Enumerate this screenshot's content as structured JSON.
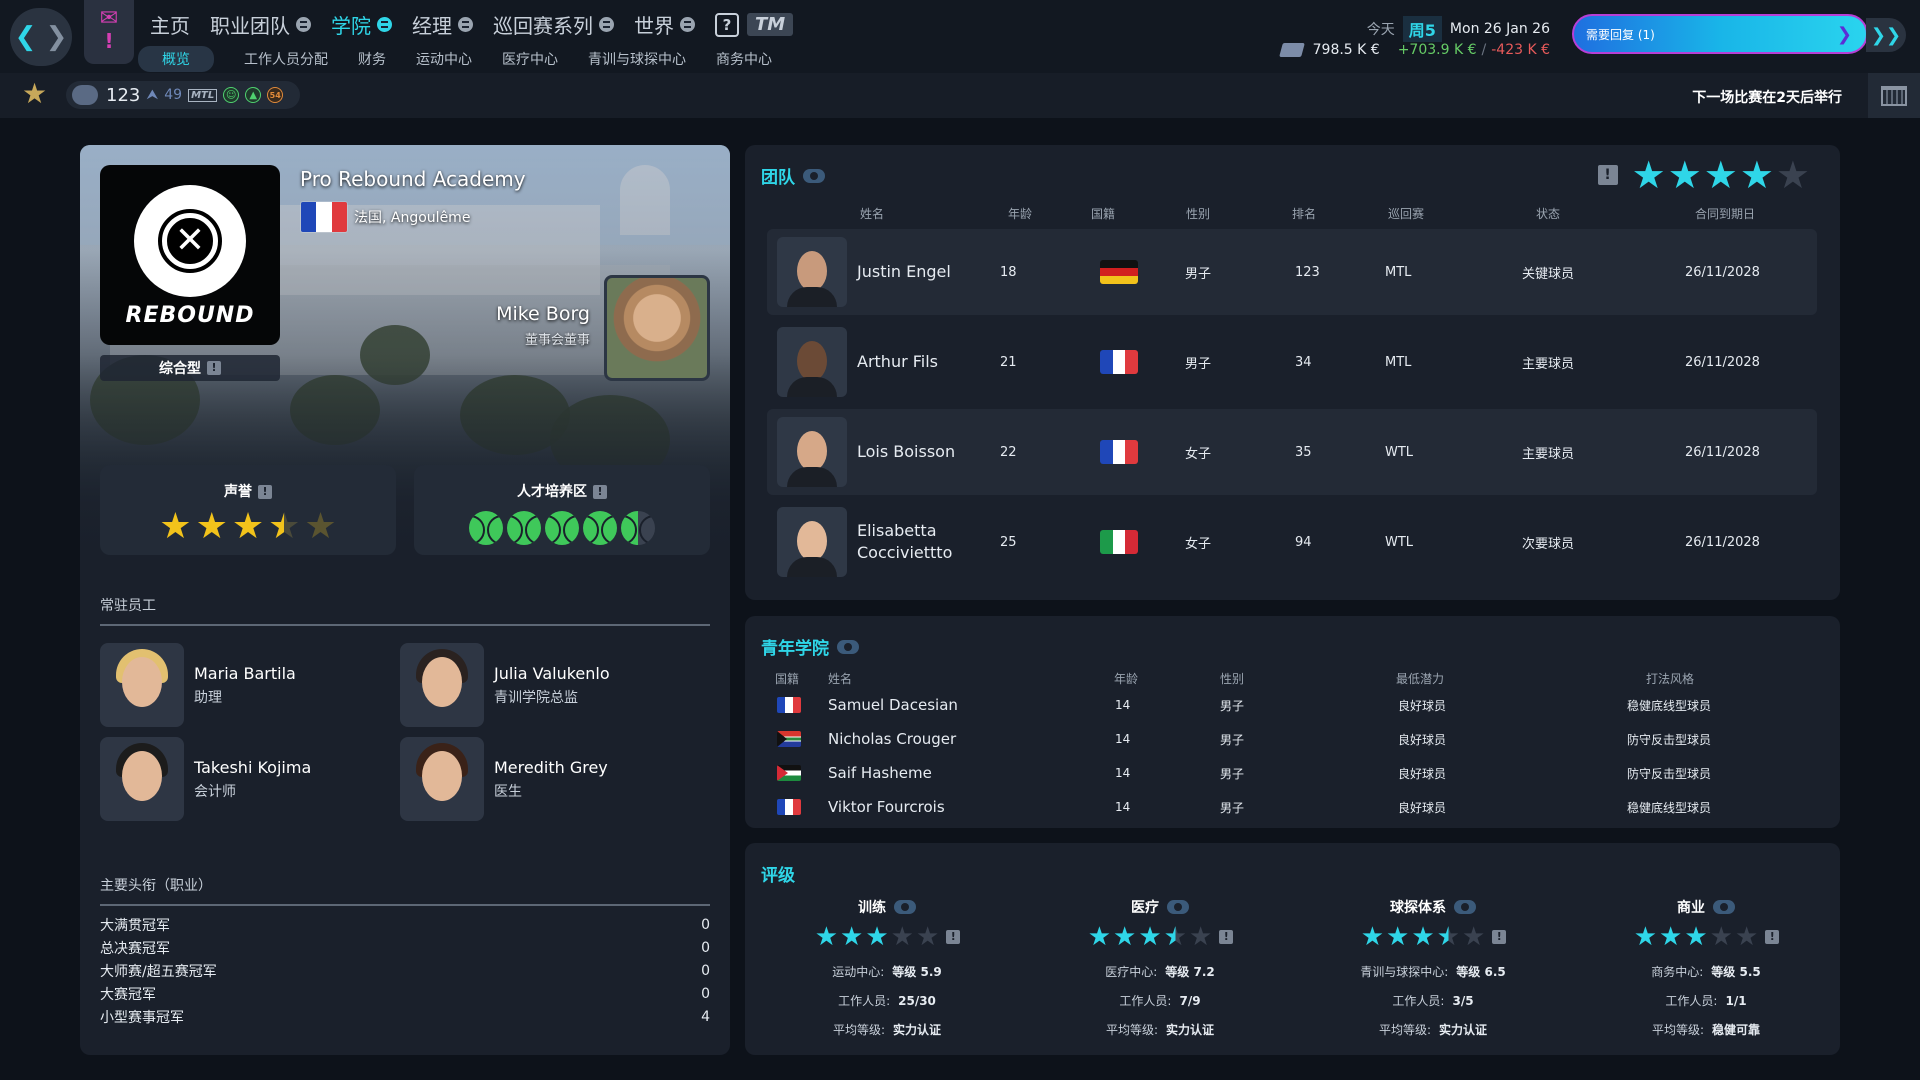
{
  "nav": {
    "back_icon": "chevron-left-icon",
    "forward_icon": "chevron-right-icon",
    "main": [
      {
        "label": "主页",
        "menu": false,
        "active": false
      },
      {
        "label": "职业团队",
        "menu": true,
        "active": false
      },
      {
        "label": "学院",
        "menu": true,
        "active": true
      },
      {
        "label": "经理",
        "menu": true,
        "active": false
      },
      {
        "label": "巡回赛系列",
        "menu": true,
        "active": false
      },
      {
        "label": "世界",
        "menu": true,
        "active": false
      }
    ],
    "help_label": "?",
    "tm_logo": "TM",
    "sub": [
      "概览",
      "工作人员分配",
      "财务",
      "运动中心",
      "医疗中心",
      "青训与球探中心",
      "商务中心"
    ]
  },
  "header": {
    "today_label": "今天",
    "week_label": "周5",
    "date": "Mon 26 Jan 26",
    "balance": "798.5 K €",
    "income": "+703.9 K €",
    "expense": "-423 K €",
    "reply_label": "需要回复 (1)"
  },
  "status": {
    "player_rank": "123",
    "player_up": "49",
    "tour": "MTL",
    "morale_value": "54",
    "next_match": "下一场比赛在2天后举行"
  },
  "academy": {
    "logo_text": "REBOUND",
    "type": "综合型",
    "name": "Pro Rebound Academy",
    "location": "法国, Angoulême",
    "director_name": "Mike Borg",
    "director_role": "董事会董事",
    "reputation_label": "声誉",
    "reputation_stars": 3.5,
    "talent_label": "人才培养区",
    "talent_balls": 4.5,
    "staff_title": "常驻员工",
    "staff": [
      {
        "name": "Maria Bartila",
        "role": "助理",
        "hair": "#e2c070"
      },
      {
        "name": "Julia Valukenlo",
        "role": "青训学院总监",
        "hair": "#2a2220"
      },
      {
        "name": "Takeshi Kojima",
        "role": "会计师",
        "hair": "#1c1c1c"
      },
      {
        "name": "Meredith Grey",
        "role": "医生",
        "hair": "#3a2218"
      }
    ],
    "titles_title": "主要头衔（职业）",
    "titles": [
      {
        "label": "大满贯冠军",
        "value": "0"
      },
      {
        "label": "总决赛冠军",
        "value": "0"
      },
      {
        "label": "大师赛/超五赛冠军",
        "value": "0"
      },
      {
        "label": "大赛冠军",
        "value": "0"
      },
      {
        "label": "小型赛事冠军",
        "value": "4"
      }
    ]
  },
  "team": {
    "title": "团队",
    "stars": 4,
    "headers": {
      "name": "姓名",
      "age": "年龄",
      "nation": "国籍",
      "gender": "性别",
      "rank": "排名",
      "tour": "巡回赛",
      "status": "状态",
      "contract": "合同到期日"
    },
    "rows": [
      {
        "name": "Justin Engel",
        "age": "18",
        "flag": "germany",
        "gender": "男子",
        "rank": "123",
        "tour": "MTL",
        "status": "关键球员",
        "contract": "26/11/2028"
      },
      {
        "name": "Arthur Fils",
        "age": "21",
        "flag": "france",
        "gender": "男子",
        "rank": "34",
        "tour": "MTL",
        "status": "主要球员",
        "contract": "26/11/2028"
      },
      {
        "name": "Lois Boisson",
        "age": "22",
        "flag": "france",
        "gender": "女子",
        "rank": "35",
        "tour": "WTL",
        "status": "主要球员",
        "contract": "26/11/2028"
      },
      {
        "name": "Elisabetta Cocciviettto",
        "age": "25",
        "flag": "italy",
        "gender": "女子",
        "rank": "94",
        "tour": "WTL",
        "status": "次要球员",
        "contract": "26/11/2028"
      }
    ]
  },
  "youth": {
    "title": "青年学院",
    "headers": {
      "nation": "国籍",
      "name": "姓名",
      "age": "年龄",
      "gender": "性别",
      "potential": "最低潜力",
      "style": "打法风格"
    },
    "rows": [
      {
        "flag": "france",
        "name": "Samuel Dacesian",
        "age": "14",
        "gender": "男子",
        "potential": "良好球员",
        "style": "稳健底线型球员"
      },
      {
        "flag": "south-africa",
        "name": "Nicholas Crouger",
        "age": "14",
        "gender": "男子",
        "potential": "良好球员",
        "style": "防守反击型球员"
      },
      {
        "flag": "jordan",
        "name": "Saif Hasheme",
        "age": "14",
        "gender": "男子",
        "potential": "良好球员",
        "style": "防守反击型球员"
      },
      {
        "flag": "france",
        "name": "Viktor Fourcrois",
        "age": "14",
        "gender": "男子",
        "potential": "良好球员",
        "style": "稳健底线型球员"
      }
    ]
  },
  "ratings": {
    "title": "评级",
    "items": [
      {
        "title": "训练",
        "stars": 3,
        "l1k": "运动中心:",
        "l1v": "等级 5.9",
        "l2k": "工作人员:",
        "l2v": "25/30",
        "l3k": "平均等级:",
        "l3v": "实力认证"
      },
      {
        "title": "医疗",
        "stars": 3.5,
        "l1k": "医疗中心:",
        "l1v": "等级 7.2",
        "l2k": "工作人员:",
        "l2v": "7/9",
        "l3k": "平均等级:",
        "l3v": "实力认证"
      },
      {
        "title": "球探体系",
        "stars": 3.5,
        "l1k": "青训与球探中心:",
        "l1v": "等级 6.5",
        "l2k": "工作人员:",
        "l2v": "3/5",
        "l3k": "平均等级:",
        "l3v": "实力认证"
      },
      {
        "title": "商业",
        "stars": 3,
        "l1k": "商务中心:",
        "l1v": "等级 5.5",
        "l2k": "工作人员:",
        "l2v": "1/1",
        "l3k": "平均等级:",
        "l3v": "稳健可靠"
      }
    ]
  }
}
